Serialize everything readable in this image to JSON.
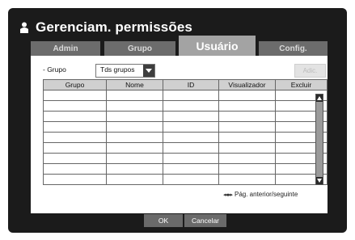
{
  "dialog": {
    "title": "Gerenciam. permissões",
    "title_icon": "user-icon"
  },
  "tabs": [
    {
      "label": "Admin",
      "active": false
    },
    {
      "label": "Grupo",
      "active": false
    },
    {
      "label": "Usuário",
      "active": true
    },
    {
      "label": "Config.",
      "active": false
    }
  ],
  "filter": {
    "label": "- Grupo",
    "selected": "Tds grupos"
  },
  "add_button": "Adic.",
  "table": {
    "columns": [
      "Grupo",
      "Nome",
      "ID",
      "Visualizador",
      "Excluir"
    ],
    "rows": [
      [
        "",
        "",
        "",
        "",
        ""
      ],
      [
        "",
        "",
        "",
        "",
        ""
      ],
      [
        "",
        "",
        "",
        "",
        ""
      ],
      [
        "",
        "",
        "",
        "",
        ""
      ],
      [
        "",
        "",
        "",
        "",
        ""
      ],
      [
        "",
        "",
        "",
        "",
        ""
      ],
      [
        "",
        "",
        "",
        "",
        ""
      ],
      [
        "",
        "",
        "",
        "",
        ""
      ],
      [
        "",
        "",
        "",
        "",
        ""
      ]
    ]
  },
  "pager": {
    "arrows": "◂◂ ▸▸",
    "label": "Pág. anterior/seguinte"
  },
  "footer": {
    "ok": "OK",
    "cancel": "Cancelar"
  }
}
